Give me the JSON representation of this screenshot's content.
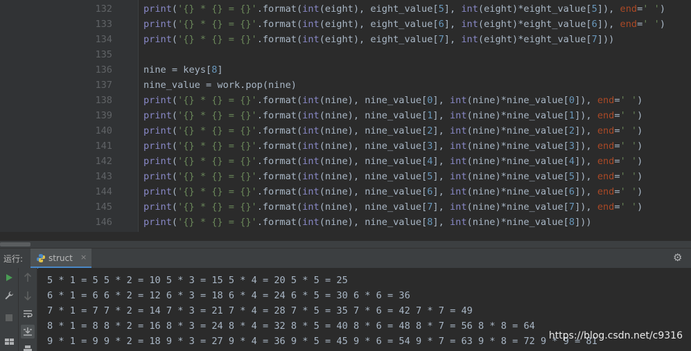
{
  "editor": {
    "lines": [
      {
        "num": "132",
        "tokens": [
          [
            "fn",
            "print"
          ],
          [
            "p",
            "("
          ],
          [
            "str",
            "'{} * {} = {}'"
          ],
          [
            "p",
            ".format("
          ],
          [
            "fn",
            "int"
          ],
          [
            "p",
            "(eight), eight_value["
          ],
          [
            "num",
            "5"
          ],
          [
            "p",
            "], "
          ],
          [
            "fn",
            "int"
          ],
          [
            "p",
            "(eight)*eight_value["
          ],
          [
            "num",
            "5"
          ],
          [
            "p",
            "]), "
          ],
          [
            "kwa",
            "end"
          ],
          [
            "p",
            "="
          ],
          [
            "str",
            "' '"
          ],
          [
            "p",
            ")"
          ]
        ]
      },
      {
        "num": "133",
        "tokens": [
          [
            "fn",
            "print"
          ],
          [
            "p",
            "("
          ],
          [
            "str",
            "'{} * {} = {}'"
          ],
          [
            "p",
            ".format("
          ],
          [
            "fn",
            "int"
          ],
          [
            "p",
            "(eight), eight_value["
          ],
          [
            "num",
            "6"
          ],
          [
            "p",
            "], "
          ],
          [
            "fn",
            "int"
          ],
          [
            "p",
            "(eight)*eight_value["
          ],
          [
            "num",
            "6"
          ],
          [
            "p",
            "]), "
          ],
          [
            "kwa",
            "end"
          ],
          [
            "p",
            "="
          ],
          [
            "str",
            "' '"
          ],
          [
            "p",
            ")"
          ]
        ]
      },
      {
        "num": "134",
        "tokens": [
          [
            "fn",
            "print"
          ],
          [
            "p",
            "("
          ],
          [
            "str",
            "'{} * {} = {}'"
          ],
          [
            "p",
            ".format("
          ],
          [
            "fn",
            "int"
          ],
          [
            "p",
            "(eight), eight_value["
          ],
          [
            "num",
            "7"
          ],
          [
            "p",
            "], "
          ],
          [
            "fn",
            "int"
          ],
          [
            "p",
            "(eight)*eight_value["
          ],
          [
            "num",
            "7"
          ],
          [
            "p",
            "]))"
          ]
        ]
      },
      {
        "num": "135",
        "tokens": []
      },
      {
        "num": "136",
        "tokens": [
          [
            "p",
            "nine = keys["
          ],
          [
            "num",
            "8"
          ],
          [
            "p",
            "]"
          ]
        ]
      },
      {
        "num": "137",
        "tokens": [
          [
            "p",
            "nine_value = work.pop(nine)"
          ]
        ]
      },
      {
        "num": "138",
        "tokens": [
          [
            "fn",
            "print"
          ],
          [
            "p",
            "("
          ],
          [
            "str",
            "'{} * {} = {}'"
          ],
          [
            "p",
            ".format("
          ],
          [
            "fn",
            "int"
          ],
          [
            "p",
            "(nine), nine_value["
          ],
          [
            "num",
            "0"
          ],
          [
            "p",
            "], "
          ],
          [
            "fn",
            "int"
          ],
          [
            "p",
            "(nine)*nine_value["
          ],
          [
            "num",
            "0"
          ],
          [
            "p",
            "]), "
          ],
          [
            "kwa",
            "end"
          ],
          [
            "p",
            "="
          ],
          [
            "str",
            "' '"
          ],
          [
            "p",
            ")"
          ]
        ]
      },
      {
        "num": "139",
        "tokens": [
          [
            "fn",
            "print"
          ],
          [
            "p",
            "("
          ],
          [
            "str",
            "'{} * {} = {}'"
          ],
          [
            "p",
            ".format("
          ],
          [
            "fn",
            "int"
          ],
          [
            "p",
            "(nine), nine_value["
          ],
          [
            "num",
            "1"
          ],
          [
            "p",
            "], "
          ],
          [
            "fn",
            "int"
          ],
          [
            "p",
            "(nine)*nine_value["
          ],
          [
            "num",
            "1"
          ],
          [
            "p",
            "]), "
          ],
          [
            "kwa",
            "end"
          ],
          [
            "p",
            "="
          ],
          [
            "str",
            "' '"
          ],
          [
            "p",
            ")"
          ]
        ]
      },
      {
        "num": "140",
        "tokens": [
          [
            "fn",
            "print"
          ],
          [
            "p",
            "("
          ],
          [
            "str",
            "'{} * {} = {}'"
          ],
          [
            "p",
            ".format("
          ],
          [
            "fn",
            "int"
          ],
          [
            "p",
            "(nine), nine_value["
          ],
          [
            "num",
            "2"
          ],
          [
            "p",
            "], "
          ],
          [
            "fn",
            "int"
          ],
          [
            "p",
            "(nine)*nine_value["
          ],
          [
            "num",
            "2"
          ],
          [
            "p",
            "]), "
          ],
          [
            "kwa",
            "end"
          ],
          [
            "p",
            "="
          ],
          [
            "str",
            "' '"
          ],
          [
            "p",
            ")"
          ]
        ]
      },
      {
        "num": "141",
        "tokens": [
          [
            "fn",
            "print"
          ],
          [
            "p",
            "("
          ],
          [
            "str",
            "'{} * {} = {}'"
          ],
          [
            "p",
            ".format("
          ],
          [
            "fn",
            "int"
          ],
          [
            "p",
            "(nine), nine_value["
          ],
          [
            "num",
            "3"
          ],
          [
            "p",
            "], "
          ],
          [
            "fn",
            "int"
          ],
          [
            "p",
            "(nine)*nine_value["
          ],
          [
            "num",
            "3"
          ],
          [
            "p",
            "]), "
          ],
          [
            "kwa",
            "end"
          ],
          [
            "p",
            "="
          ],
          [
            "str",
            "' '"
          ],
          [
            "p",
            ")"
          ]
        ]
      },
      {
        "num": "142",
        "tokens": [
          [
            "fn",
            "print"
          ],
          [
            "p",
            "("
          ],
          [
            "str",
            "'{} * {} = {}'"
          ],
          [
            "p",
            ".format("
          ],
          [
            "fn",
            "int"
          ],
          [
            "p",
            "(nine), nine_value["
          ],
          [
            "num",
            "4"
          ],
          [
            "p",
            "], "
          ],
          [
            "fn",
            "int"
          ],
          [
            "p",
            "(nine)*nine_value["
          ],
          [
            "num",
            "4"
          ],
          [
            "p",
            "]), "
          ],
          [
            "kwa",
            "end"
          ],
          [
            "p",
            "="
          ],
          [
            "str",
            "' '"
          ],
          [
            "p",
            ")"
          ]
        ]
      },
      {
        "num": "143",
        "tokens": [
          [
            "fn",
            "print"
          ],
          [
            "p",
            "("
          ],
          [
            "str",
            "'{} * {} = {}'"
          ],
          [
            "p",
            ".format("
          ],
          [
            "fn",
            "int"
          ],
          [
            "p",
            "(nine), nine_value["
          ],
          [
            "num",
            "5"
          ],
          [
            "p",
            "], "
          ],
          [
            "fn",
            "int"
          ],
          [
            "p",
            "(nine)*nine_value["
          ],
          [
            "num",
            "5"
          ],
          [
            "p",
            "]), "
          ],
          [
            "kwa",
            "end"
          ],
          [
            "p",
            "="
          ],
          [
            "str",
            "' '"
          ],
          [
            "p",
            ")"
          ]
        ]
      },
      {
        "num": "144",
        "tokens": [
          [
            "fn",
            "print"
          ],
          [
            "p",
            "("
          ],
          [
            "str",
            "'{} * {} = {}'"
          ],
          [
            "p",
            ".format("
          ],
          [
            "fn",
            "int"
          ],
          [
            "p",
            "(nine), nine_value["
          ],
          [
            "num",
            "6"
          ],
          [
            "p",
            "], "
          ],
          [
            "fn",
            "int"
          ],
          [
            "p",
            "(nine)*nine_value["
          ],
          [
            "num",
            "6"
          ],
          [
            "p",
            "]), "
          ],
          [
            "kwa",
            "end"
          ],
          [
            "p",
            "="
          ],
          [
            "str",
            "' '"
          ],
          [
            "p",
            ")"
          ]
        ]
      },
      {
        "num": "145",
        "tokens": [
          [
            "fn",
            "print"
          ],
          [
            "p",
            "("
          ],
          [
            "str",
            "'{} * {} = {}'"
          ],
          [
            "p",
            ".format("
          ],
          [
            "fn",
            "int"
          ],
          [
            "p",
            "(nine), nine_value["
          ],
          [
            "num",
            "7"
          ],
          [
            "p",
            "], "
          ],
          [
            "fn",
            "int"
          ],
          [
            "p",
            "(nine)*nine_value["
          ],
          [
            "num",
            "7"
          ],
          [
            "p",
            "]), "
          ],
          [
            "kwa",
            "end"
          ],
          [
            "p",
            "="
          ],
          [
            "str",
            "' '"
          ],
          [
            "p",
            ")"
          ]
        ]
      },
      {
        "num": "146",
        "tokens": [
          [
            "fn",
            "print"
          ],
          [
            "p",
            "("
          ],
          [
            "str",
            "'{} * {} = {}'"
          ],
          [
            "p",
            ".format("
          ],
          [
            "fn",
            "int"
          ],
          [
            "p",
            "(nine), nine_value["
          ],
          [
            "num",
            "8"
          ],
          [
            "p",
            "], "
          ],
          [
            "fn",
            "int"
          ],
          [
            "p",
            "(nine)*nine_value["
          ],
          [
            "num",
            "8"
          ],
          [
            "p",
            "]))"
          ]
        ]
      }
    ]
  },
  "run_panel": {
    "label": "运行:",
    "tab_name": "struct",
    "tab_close": "×",
    "settings_icon": "gear-icon"
  },
  "toolbar_left": [
    "run-icon",
    "wrench-icon",
    "stop-icon",
    "layout-icon"
  ],
  "toolbar_right": [
    "arrow-up-icon",
    "arrow-down-icon",
    "soft-wrap-icon",
    "scroll-to-end-icon",
    "print-icon"
  ],
  "console": {
    "lines": [
      "5 * 1 = 5 5 * 2 = 10 5 * 3 = 15 5 * 4 = 20 5 * 5 = 25",
      "6 * 1 = 6 6 * 2 = 12 6 * 3 = 18 6 * 4 = 24 6 * 5 = 30 6 * 6 = 36",
      "7 * 1 = 7 7 * 2 = 14 7 * 3 = 21 7 * 4 = 28 7 * 5 = 35 7 * 6 = 42 7 * 7 = 49",
      "8 * 1 = 8 8 * 2 = 16 8 * 3 = 24 8 * 4 = 32 8 * 5 = 40 8 * 6 = 48 8 * 7 = 56 8 * 8 = 64",
      "9 * 1 = 9 9 * 2 = 18 9 * 3 = 27 9 * 4 = 36 9 * 5 = 45 9 * 6 = 54 9 * 7 = 63 9 * 8 = 72 9 * 9 = 81"
    ]
  },
  "watermark": "https://blog.csdn.net/c9316",
  "colors": {
    "background": "#2b2b2b",
    "gutter": "#313335",
    "panel": "#3c3f41",
    "string": "#6a8759",
    "builtin": "#8888c6",
    "keyword_arg": "#aa4926",
    "number": "#6897bb",
    "run_green": "#499c54",
    "tab_underline": "#4a88c7"
  }
}
